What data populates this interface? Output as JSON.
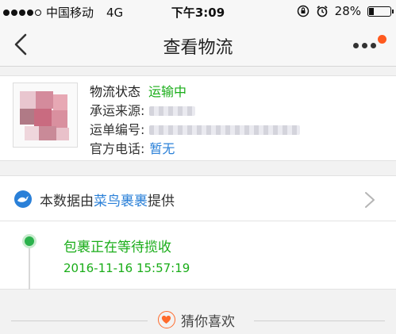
{
  "status_bar": {
    "carrier": "中国移动",
    "network": "4G",
    "time": "下午3:09",
    "battery_percent": "28%",
    "battery_level": 0.28
  },
  "nav": {
    "title": "查看物流"
  },
  "logistics": {
    "status_label": "物流状态",
    "status_value": "运输中",
    "carrier_label": "承运来源:",
    "tracking_label": "运单编号:",
    "phone_label": "官方电话:",
    "phone_value": "暂无"
  },
  "provider": {
    "prefix": "本数据由",
    "brand": "菜鸟裹裹",
    "suffix": "提供"
  },
  "timeline": [
    {
      "status": "包裹正在等待揽收",
      "time": "2016-11-16 15:57:19"
    }
  ],
  "guess": {
    "label": "猜你喜欢"
  },
  "colors": {
    "green": "#1aad19",
    "link_blue": "#2a80d8",
    "accent_orange": "#ff5a1f"
  }
}
